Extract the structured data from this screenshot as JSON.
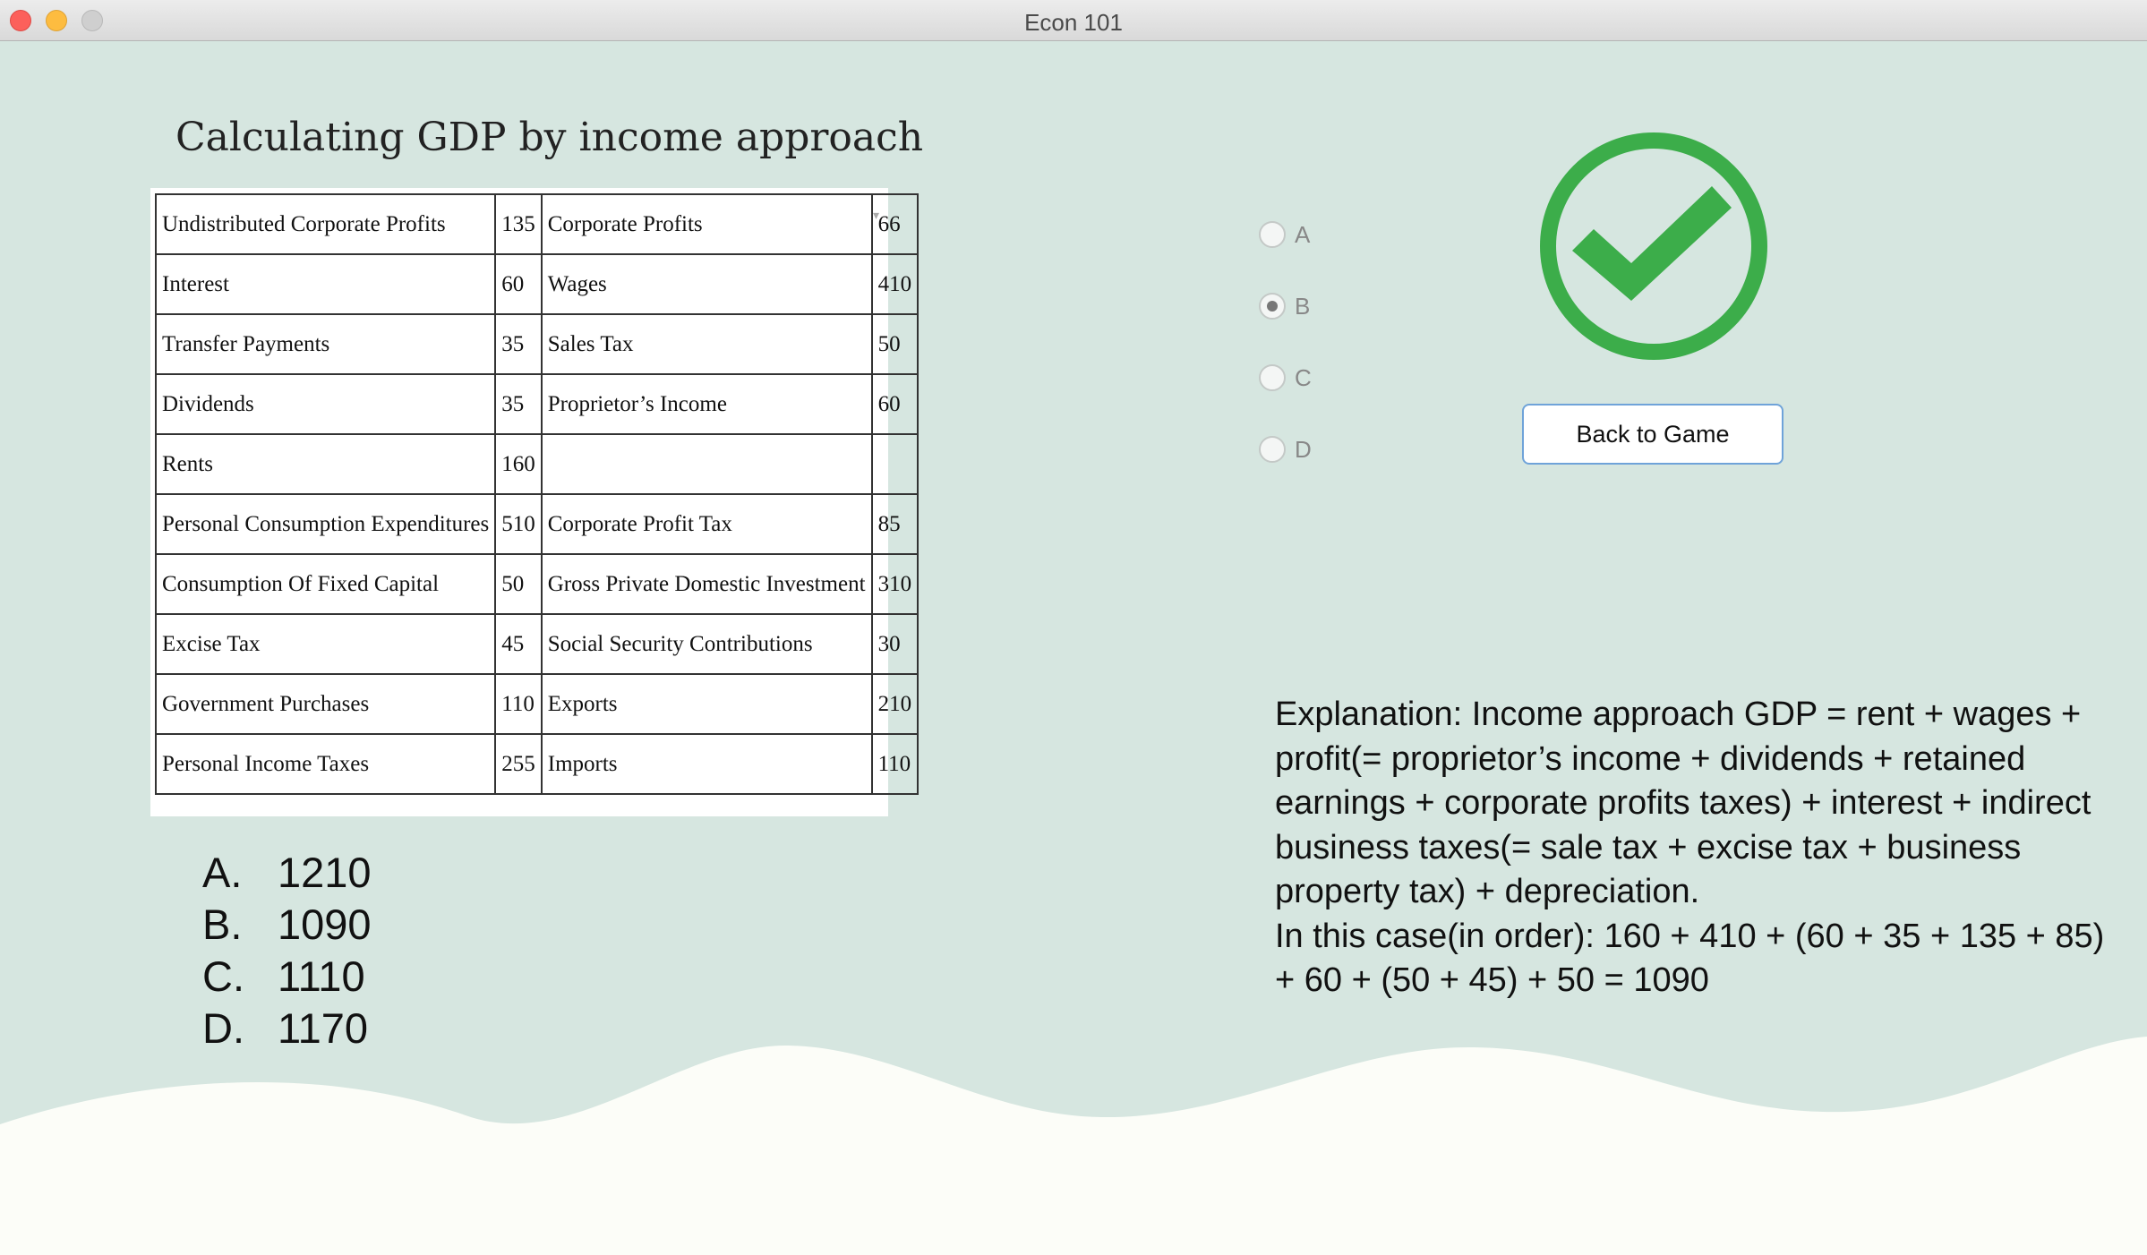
{
  "window": {
    "title": "Econ 101"
  },
  "question": {
    "title": "Calculating GDP by income approach"
  },
  "table": {
    "rows": [
      [
        "Undistributed Corporate Profits",
        "135",
        "Corporate Profits",
        "66"
      ],
      [
        "Interest",
        "60",
        "Wages",
        "410"
      ],
      [
        "Transfer Payments",
        "35",
        "Sales Tax",
        "50"
      ],
      [
        "Dividends",
        "35",
        "Proprietor’s Income",
        "60"
      ],
      [
        "Rents",
        "160",
        "",
        ""
      ],
      [
        "Personal Consumption Expenditures",
        "510",
        "Corporate Profit Tax",
        "85"
      ],
      [
        "Consumption Of Fixed Capital",
        "50",
        "Gross Private Domestic Investment",
        "310"
      ],
      [
        "Excise Tax",
        "45",
        "Social Security Contributions",
        "30"
      ],
      [
        "Government Purchases",
        "110",
        "Exports",
        "210"
      ],
      [
        "Personal Income Taxes",
        "255",
        "Imports",
        "110"
      ]
    ]
  },
  "answers": [
    {
      "letter": "A.",
      "value": "1210"
    },
    {
      "letter": "B.",
      "value": "1090"
    },
    {
      "letter": "C.",
      "value": "1110"
    },
    {
      "letter": "D.",
      "value": "1170"
    }
  ],
  "choices": [
    {
      "label": "A",
      "selected": false
    },
    {
      "label": "B",
      "selected": true
    },
    {
      "label": "C",
      "selected": false
    },
    {
      "label": "D",
      "selected": false
    }
  ],
  "result": {
    "icon": "checkmark-circle-icon",
    "color": "#3cad4a"
  },
  "back_button": {
    "label": "Back to Game"
  },
  "explanation": {
    "line1": "Explanation: Income approach GDP = rent + wages + profit(= proprietor’s income + dividends + retained earnings + corporate profits taxes)  + interest + indirect business taxes(= sale tax + excise tax + business property tax) + depreciation.",
    "line2": "In this case(in order): 160 + 410 + (60 + 35 + 135 + 85) + 60 + (50 + 45) + 50 = 1090"
  },
  "colors": {
    "background": "#d6e6e0",
    "wave": "#fcfdf8",
    "button_border": "#6fa3d9"
  }
}
